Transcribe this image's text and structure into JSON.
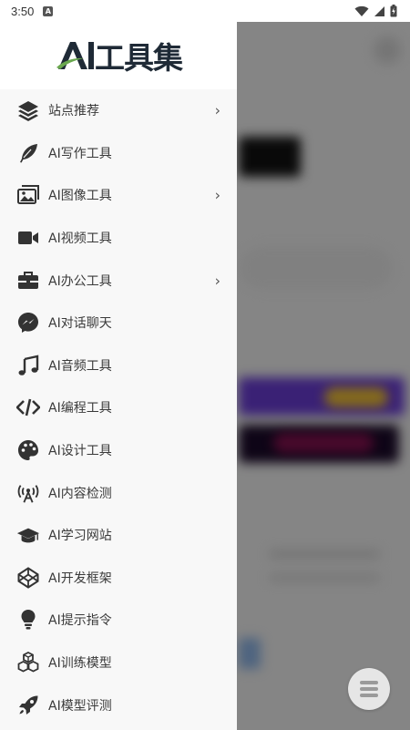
{
  "status_bar": {
    "time": "3:50",
    "notification_icon": "a-icon"
  },
  "drawer": {
    "logo_text": "AI工具集",
    "logo_colors": {
      "dark": "#1f2a36",
      "accent": "#6aa84f"
    },
    "items": [
      {
        "label": "站点推荐",
        "icon": "layers-icon",
        "has_submenu": true
      },
      {
        "label": "AI写作工具",
        "icon": "feather-icon",
        "has_submenu": false
      },
      {
        "label": "AI图像工具",
        "icon": "images-icon",
        "has_submenu": true
      },
      {
        "label": "AI视频工具",
        "icon": "video-camera-icon",
        "has_submenu": false
      },
      {
        "label": "AI办公工具",
        "icon": "briefcase-icon",
        "has_submenu": true
      },
      {
        "label": "AI对话聊天",
        "icon": "messenger-icon",
        "has_submenu": false
      },
      {
        "label": "AI音频工具",
        "icon": "music-note-icon",
        "has_submenu": false
      },
      {
        "label": "AI编程工具",
        "icon": "code-icon",
        "has_submenu": false
      },
      {
        "label": "AI设计工具",
        "icon": "palette-icon",
        "has_submenu": false
      },
      {
        "label": "AI内容检测",
        "icon": "broadcast-icon",
        "has_submenu": false
      },
      {
        "label": "AI学习网站",
        "icon": "graduation-cap-icon",
        "has_submenu": false
      },
      {
        "label": "AI开发框架",
        "icon": "codepen-icon",
        "has_submenu": false
      },
      {
        "label": "AI提示指令",
        "icon": "lightbulb-icon",
        "has_submenu": false
      },
      {
        "label": "AI训练模型",
        "icon": "cubes-icon",
        "has_submenu": false
      },
      {
        "label": "AI模型评测",
        "icon": "rocket-icon",
        "has_submenu": false
      }
    ],
    "chevron": "›"
  },
  "fab": {
    "icon": "menu-icon"
  }
}
